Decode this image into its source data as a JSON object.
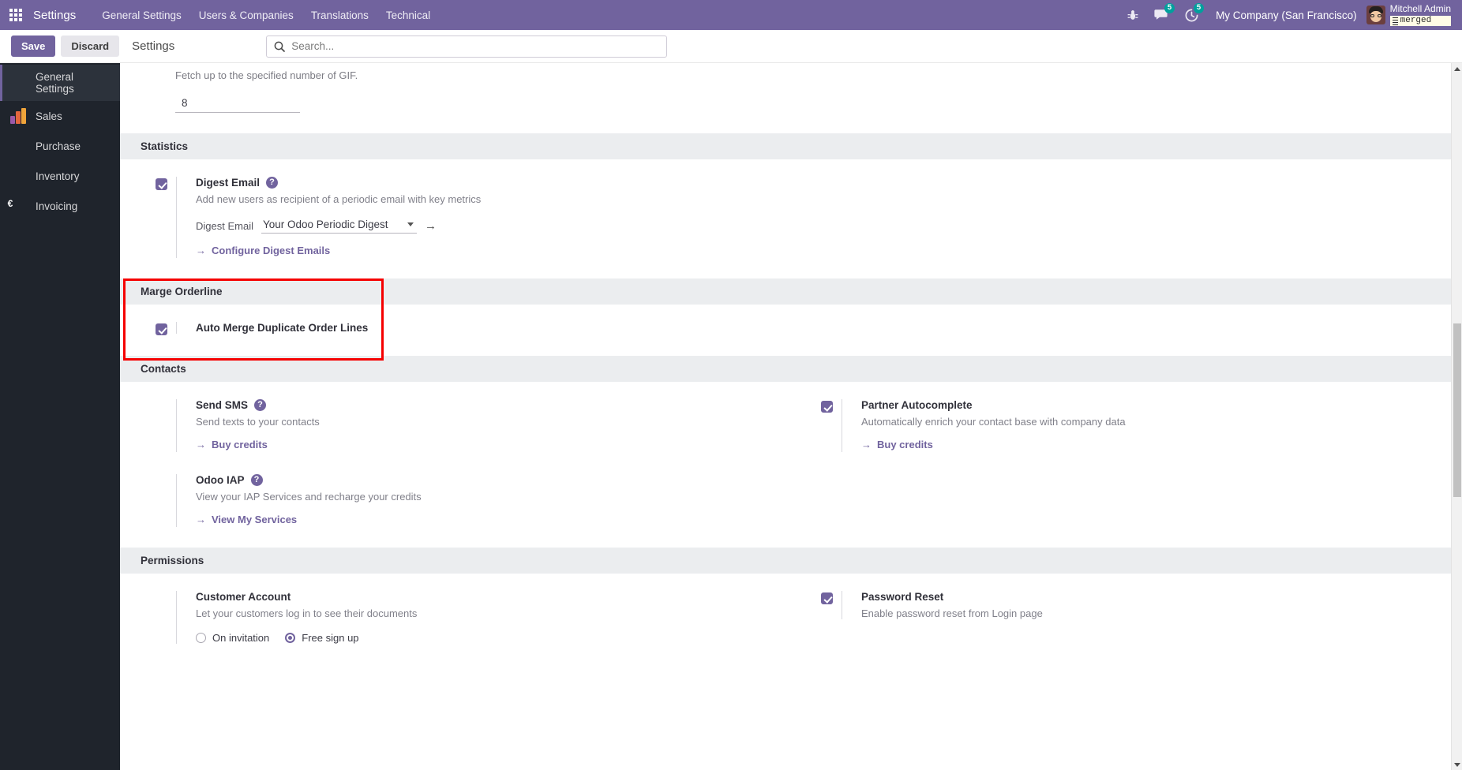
{
  "navbar": {
    "apps_icon": "apps-grid-icon",
    "brand": "Settings",
    "menus": [
      "General Settings",
      "Users & Companies",
      "Translations",
      "Technical"
    ],
    "bug_icon": "bug-icon",
    "messages": {
      "icon": "chat-icon",
      "count": "5"
    },
    "activities": {
      "icon": "clock-icon",
      "count": "5"
    },
    "company": "My Company (San Francisco)",
    "user": {
      "name": "Mitchell Admin",
      "database": "merged",
      "avatar": "user-avatar"
    }
  },
  "control_panel": {
    "save_label": "Save",
    "discard_label": "Discard",
    "title": "Settings",
    "search_placeholder": "Search..."
  },
  "sidebar": {
    "items": [
      {
        "label": "General Settings",
        "icon": "settings-app-icon",
        "active": true
      },
      {
        "label": "Sales",
        "icon": "sales-app-icon",
        "active": false
      },
      {
        "label": "Purchase",
        "icon": "purchase-app-icon",
        "active": false
      },
      {
        "label": "Inventory",
        "icon": "inventory-app-icon",
        "active": false
      },
      {
        "label": "Invoicing",
        "icon": "invoicing-app-icon",
        "active": false
      }
    ]
  },
  "top_partial": {
    "help": "Fetch up to the specified number of GIF.",
    "value": "8"
  },
  "sections": {
    "statistics": {
      "title": "Statistics",
      "digest_email": {
        "title": "Digest Email",
        "help_icon": "question-mark-icon",
        "description": "Add new users as recipient of a periodic email with key metrics",
        "field_label": "Digest Email",
        "field_value": "Your Odoo Periodic Digest",
        "internal_link_icon": "arrow-right-icon",
        "link": "Configure Digest Emails",
        "checked": true
      }
    },
    "marge_orderline": {
      "title": "Marge Orderline",
      "highlighted": true,
      "auto_merge": {
        "title": "Auto Merge Duplicate Order Lines",
        "checked": true
      }
    },
    "contacts": {
      "title": "Contacts",
      "send_sms": {
        "title": "Send SMS",
        "help_icon": "question-mark-icon",
        "description": "Send texts to your contacts",
        "link": "Buy credits",
        "checked": false
      },
      "partner_autocomplete": {
        "title": "Partner Autocomplete",
        "description": "Automatically enrich your contact base with company data",
        "link": "Buy credits",
        "checked": true
      },
      "odoo_iap": {
        "title": "Odoo IAP",
        "help_icon": "question-mark-icon",
        "description": "View your IAP Services and recharge your credits",
        "link": "View My Services",
        "checked": false
      }
    },
    "permissions": {
      "title": "Permissions",
      "customer_account": {
        "title": "Customer Account",
        "description": "Let your customers log in to see their documents",
        "options": [
          {
            "label": "On invitation",
            "selected": false
          },
          {
            "label": "Free sign up",
            "selected": true
          }
        ]
      },
      "password_reset": {
        "title": "Password Reset",
        "description": "Enable password reset from Login page",
        "checked": true
      }
    }
  },
  "colors": {
    "brand_purple": "#71639e",
    "navbar": "#71639e",
    "sidebar": "#1f242c",
    "section_header": "#ebedef",
    "highlight_red": "#f50000",
    "badge_green": "#00a09d"
  }
}
